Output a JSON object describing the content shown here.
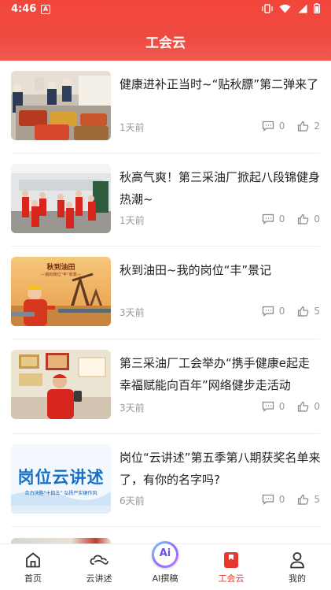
{
  "status": {
    "time": "4:46",
    "notification": "A"
  },
  "header": {
    "title": "工会云"
  },
  "articles": [
    {
      "title": "健康进补正当时~“贴秋膘”第二弹来了",
      "time": "1天前",
      "comments": "0",
      "likes": "2"
    },
    {
      "title": "秋高气爽！第三采油厂掀起八段锦健身热潮~",
      "time": "1天前",
      "comments": "0",
      "likes": "0"
    },
    {
      "title": "秋到油田~我的岗位“丰”景记",
      "time": "3天前",
      "comments": "0",
      "likes": "5",
      "thumb_title": "秋到油田",
      "thumb_sub": "—我的岗位“丰”收季—"
    },
    {
      "title": "第三采油厂工会举办“携手健康e起走 幸福赋能向百年”网络健步走活动",
      "time": "3天前",
      "comments": "0",
      "likes": "0"
    },
    {
      "title": "岗位“云讲述”第五季第八期获奖名单来了，有你的名字吗?",
      "time": "6天前",
      "comments": "0",
      "likes": "5",
      "thumb_title": "岗位云讲述",
      "thumb_sub": "合力决胜“十四五” 弘扬严实硬作风"
    }
  ],
  "tabs": [
    {
      "label": "首页",
      "icon": "home-icon"
    },
    {
      "label": "云讲述",
      "icon": "cloud-icon"
    },
    {
      "label": "AI撰稿",
      "icon": "ai-icon",
      "badge": "Ai"
    },
    {
      "label": "工会云",
      "icon": "bookmark-icon"
    },
    {
      "label": "我的",
      "icon": "user-icon"
    }
  ],
  "colors": {
    "accent": "#e8382d",
    "header": "#f2463b",
    "ai": "#7b61ff"
  }
}
